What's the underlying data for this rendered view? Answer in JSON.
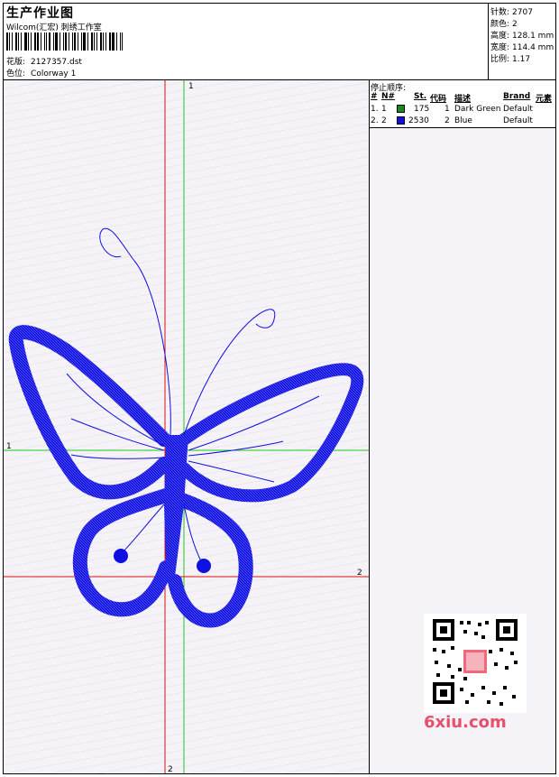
{
  "header": {
    "title": "生产作业图",
    "company": "Wilcom(汇宏) 刺绣工作室",
    "design_label": "花版:",
    "design_value": "2127357.dst",
    "colorway_label": "色位:",
    "colorway_value": "Colorway 1"
  },
  "stats": [
    {
      "label": "针数:",
      "value": "2707"
    },
    {
      "label": "颜色:",
      "value": "2"
    },
    {
      "label": "高度:",
      "value": "128.1 mm"
    },
    {
      "label": "宽度:",
      "value": "114.4 mm"
    },
    {
      "label": "比例:",
      "value": "1.17"
    }
  ],
  "stop_table": {
    "title": "停止顺序:",
    "headers": [
      "#",
      "N#",
      "St.",
      "代码",
      "描述",
      "Brand",
      "元素"
    ],
    "rows": [
      {
        "num": "1.",
        "n": "1",
        "color": "#1a8a1a",
        "st": "175",
        "code": "1",
        "desc": "Dark Green",
        "brand": "Default"
      },
      {
        "num": "2.",
        "n": "2",
        "color": "#1010e0",
        "st": "2530",
        "code": "2",
        "desc": "Blue",
        "brand": "Default"
      }
    ]
  },
  "axes": {
    "green_label_top": "1",
    "green_label_left": "1",
    "red_label_right": "2",
    "red_label_bottom": "2",
    "green_color": "#1ec81e",
    "red_color": "#e01010"
  },
  "design_color": "#1010e0",
  "watermark": "6xiu.com"
}
